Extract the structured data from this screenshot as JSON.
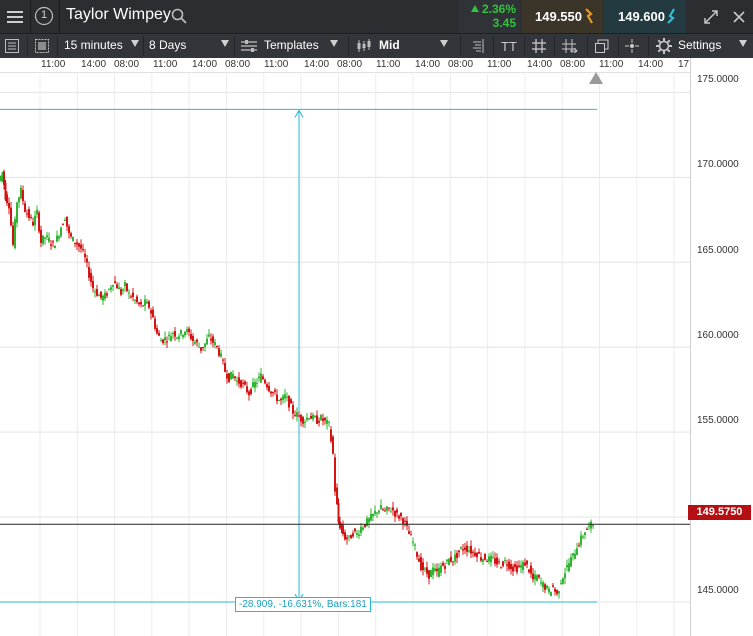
{
  "header": {
    "instrument_title": "Taylor Wimpey",
    "info_badge": "1",
    "change_pct": "2.36%",
    "change_abs": "3.45",
    "sell_price": "149.550",
    "buy_price": "149.600"
  },
  "toolbar": {
    "interval": "15 minutes",
    "range": "8 Days",
    "templates_label": "Templates",
    "price_type": "Mid",
    "text_tool": "TT",
    "settings_label": "Settings"
  },
  "colors": {
    "up": "#2fb52f",
    "down": "#d41414",
    "measure": "#28b8d0",
    "last_price_bg": "#b50f14"
  },
  "chart_data": {
    "type": "candlestick",
    "x_tick_labels": [
      "11:00",
      "14:00",
      "08:00",
      "11:00",
      "14:00",
      "08:00",
      "11:00",
      "14:00",
      "08:00",
      "11:00",
      "14:00",
      "08:00",
      "11:00",
      "14:00",
      "08:00",
      "11:00",
      "14:00",
      "17:00"
    ],
    "y_tick_labels": [
      "175.0000",
      "170.0000",
      "165.0000",
      "160.0000",
      "155.0000",
      "150.0000",
      "145.0000"
    ],
    "ylim": [
      143.0,
      176.2
    ],
    "grid": true,
    "last_price": "149.5750",
    "measure_top": 174.0,
    "measure_bottom": 145.0,
    "measure_label": "-28.909, -16.631%, Bars:181",
    "path": [
      [
        0,
        169.8
      ],
      [
        3,
        170.3
      ],
      [
        6,
        168.9
      ],
      [
        10,
        168.4
      ],
      [
        14,
        166.0
      ],
      [
        18,
        168.6
      ],
      [
        22,
        169.2
      ],
      [
        26,
        168.1
      ],
      [
        30,
        167.7
      ],
      [
        34,
        167.3
      ],
      [
        38,
        167.9
      ],
      [
        42,
        166.2
      ],
      [
        46,
        166.5
      ],
      [
        50,
        166.3
      ],
      [
        54,
        166.0
      ],
      [
        58,
        166.4
      ],
      [
        62,
        167.1
      ],
      [
        66,
        167.7
      ],
      [
        70,
        166.6
      ],
      [
        74,
        166.3
      ],
      [
        78,
        166.1
      ],
      [
        82,
        165.8
      ],
      [
        86,
        165.2
      ],
      [
        90,
        164.3
      ],
      [
        94,
        163.5
      ],
      [
        98,
        163.2
      ],
      [
        102,
        162.9
      ],
      [
        106,
        163.0
      ],
      [
        110,
        163.4
      ],
      [
        114,
        163.9
      ],
      [
        118,
        163.6
      ],
      [
        122,
        163.2
      ],
      [
        126,
        163.6
      ],
      [
        130,
        163.1
      ],
      [
        134,
        162.9
      ],
      [
        138,
        162.6
      ],
      [
        142,
        162.4
      ],
      [
        146,
        162.6
      ],
      [
        150,
        162.4
      ],
      [
        154,
        161.7
      ],
      [
        158,
        160.8
      ],
      [
        162,
        160.4
      ],
      [
        166,
        160.5
      ],
      [
        170,
        160.6
      ],
      [
        174,
        160.9
      ],
      [
        178,
        160.7
      ],
      [
        182,
        160.8
      ],
      [
        186,
        161.0
      ],
      [
        190,
        160.8
      ],
      [
        194,
        160.4
      ],
      [
        198,
        160.2
      ],
      [
        202,
        159.9
      ],
      [
        206,
        160.2
      ],
      [
        210,
        160.6
      ],
      [
        214,
        160.3
      ],
      [
        218,
        160.0
      ],
      [
        222,
        159.4
      ],
      [
        226,
        158.6
      ],
      [
        230,
        158.2
      ],
      [
        234,
        158.4
      ],
      [
        238,
        158.0
      ],
      [
        242,
        157.9
      ],
      [
        246,
        157.6
      ],
      [
        250,
        157.3
      ],
      [
        254,
        157.7
      ],
      [
        258,
        158.0
      ],
      [
        262,
        158.3
      ],
      [
        266,
        158.0
      ],
      [
        270,
        157.6
      ],
      [
        274,
        157.3
      ],
      [
        278,
        157.0
      ],
      [
        282,
        156.8
      ],
      [
        286,
        157.1
      ],
      [
        290,
        156.7
      ],
      [
        294,
        156.2
      ],
      [
        298,
        156.0
      ],
      [
        302,
        155.8
      ],
      [
        306,
        155.7
      ],
      [
        310,
        156.0
      ],
      [
        314,
        155.8
      ],
      [
        318,
        155.7
      ],
      [
        322,
        155.8
      ],
      [
        326,
        155.6
      ],
      [
        330,
        155.4
      ],
      [
        334,
        153.7
      ],
      [
        336,
        151.6
      ],
      [
        339,
        149.7
      ],
      [
        342,
        149.3
      ],
      [
        346,
        148.8
      ],
      [
        350,
        148.7
      ],
      [
        354,
        149.1
      ],
      [
        358,
        149.0
      ],
      [
        362,
        149.4
      ],
      [
        366,
        149.6
      ],
      [
        370,
        149.8
      ],
      [
        374,
        150.1
      ],
      [
        378,
        150.4
      ],
      [
        382,
        150.5
      ],
      [
        386,
        150.3
      ],
      [
        390,
        150.5
      ],
      [
        394,
        150.4
      ],
      [
        398,
        150.1
      ],
      [
        402,
        150.0
      ],
      [
        406,
        149.6
      ],
      [
        410,
        149.0
      ],
      [
        414,
        148.5
      ],
      [
        418,
        147.8
      ],
      [
        422,
        147.1
      ],
      [
        426,
        146.8
      ],
      [
        430,
        146.6
      ],
      [
        434,
        146.9
      ],
      [
        438,
        146.7
      ],
      [
        442,
        147.1
      ],
      [
        446,
        147.2
      ],
      [
        450,
        147.5
      ],
      [
        454,
        147.5
      ],
      [
        458,
        147.8
      ],
      [
        462,
        148.1
      ],
      [
        466,
        148.2
      ],
      [
        470,
        148.1
      ],
      [
        474,
        147.9
      ],
      [
        478,
        147.9
      ],
      [
        482,
        147.6
      ],
      [
        486,
        147.6
      ],
      [
        490,
        147.5
      ],
      [
        494,
        147.5
      ],
      [
        498,
        147.3
      ],
      [
        502,
        147.2
      ],
      [
        506,
        147.4
      ],
      [
        510,
        147.2
      ],
      [
        514,
        147.0
      ],
      [
        518,
        147.0
      ],
      [
        522,
        147.1
      ],
      [
        526,
        147.3
      ],
      [
        530,
        146.9
      ],
      [
        534,
        146.3
      ],
      [
        538,
        146.5
      ],
      [
        542,
        146.1
      ],
      [
        546,
        145.9
      ],
      [
        550,
        145.6
      ],
      [
        554,
        145.9
      ],
      [
        558,
        145.4
      ],
      [
        562,
        146.3
      ],
      [
        566,
        146.8
      ],
      [
        570,
        147.3
      ],
      [
        574,
        147.7
      ],
      [
        578,
        148.3
      ],
      [
        582,
        148.7
      ],
      [
        586,
        149.2
      ],
      [
        590,
        149.4
      ],
      [
        594,
        149.6
      ]
    ]
  }
}
